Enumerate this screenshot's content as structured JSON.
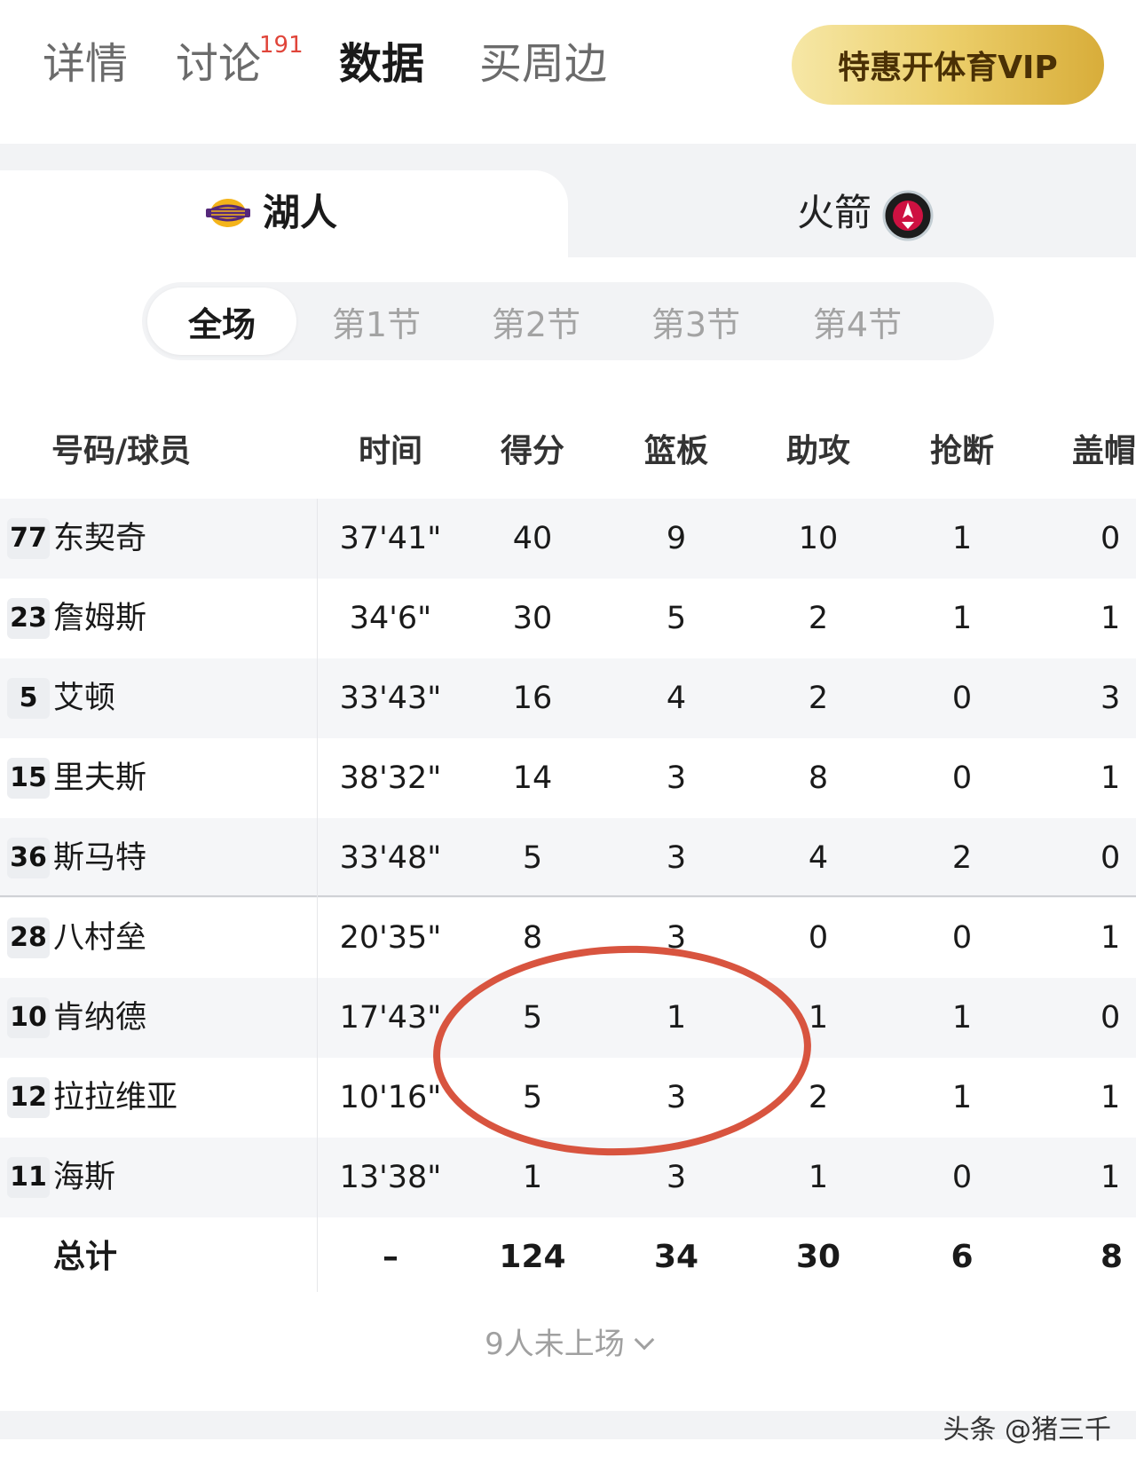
{
  "nav": {
    "tabs": [
      {
        "label": "详情"
      },
      {
        "label": "讨论",
        "badge": "191"
      },
      {
        "label": "数据"
      },
      {
        "label": "买周边"
      }
    ],
    "vip_button": "特惠开体育VIP"
  },
  "teams": {
    "left": {
      "name": "湖人",
      "logo_icon": "lakers-logo-icon"
    },
    "right": {
      "name": "火箭",
      "logo_icon": "rockets-logo-icon"
    }
  },
  "periods": [
    "全场",
    "第1节",
    "第2节",
    "第3节",
    "第4节"
  ],
  "table": {
    "headers": [
      "号码/球员",
      "时间",
      "得分",
      "篮板",
      "助攻",
      "抢断",
      "盖帽"
    ],
    "rows": [
      {
        "num": "77",
        "name": "东契奇",
        "time": "37'41\"",
        "pts": "40",
        "reb": "9",
        "ast": "10",
        "stl": "1",
        "blk": "0"
      },
      {
        "num": "23",
        "name": "詹姆斯",
        "time": "34'6\"",
        "pts": "30",
        "reb": "5",
        "ast": "2",
        "stl": "1",
        "blk": "1"
      },
      {
        "num": "5",
        "name": "艾顿",
        "time": "33'43\"",
        "pts": "16",
        "reb": "4",
        "ast": "2",
        "stl": "0",
        "blk": "3"
      },
      {
        "num": "15",
        "name": "里夫斯",
        "time": "38'32\"",
        "pts": "14",
        "reb": "3",
        "ast": "8",
        "stl": "0",
        "blk": "1"
      },
      {
        "num": "36",
        "name": "斯马特",
        "time": "33'48\"",
        "pts": "5",
        "reb": "3",
        "ast": "4",
        "stl": "2",
        "blk": "0"
      },
      {
        "num": "28",
        "name": "八村垒",
        "time": "20'35\"",
        "pts": "8",
        "reb": "3",
        "ast": "0",
        "stl": "0",
        "blk": "1"
      },
      {
        "num": "10",
        "name": "肯纳德",
        "time": "17'43\"",
        "pts": "5",
        "reb": "1",
        "ast": "1",
        "stl": "1",
        "blk": "0"
      },
      {
        "num": "12",
        "name": "拉拉维亚",
        "time": "10'16\"",
        "pts": "5",
        "reb": "3",
        "ast": "2",
        "stl": "1",
        "blk": "1"
      },
      {
        "num": "11",
        "name": "海斯",
        "time": "13'38\"",
        "pts": "1",
        "reb": "3",
        "ast": "1",
        "stl": "0",
        "blk": "1"
      }
    ],
    "total": {
      "label": "总计",
      "time": "–",
      "pts": "124",
      "reb": "34",
      "ast": "30",
      "stl": "6",
      "blk": "8"
    }
  },
  "bench_toggle": "9人未上场",
  "watermark": "头条 @猪三千",
  "colors": {
    "badge": "#e0453a",
    "vip_gold": "#eccf6b",
    "annotation_circle": "#d5452f"
  }
}
